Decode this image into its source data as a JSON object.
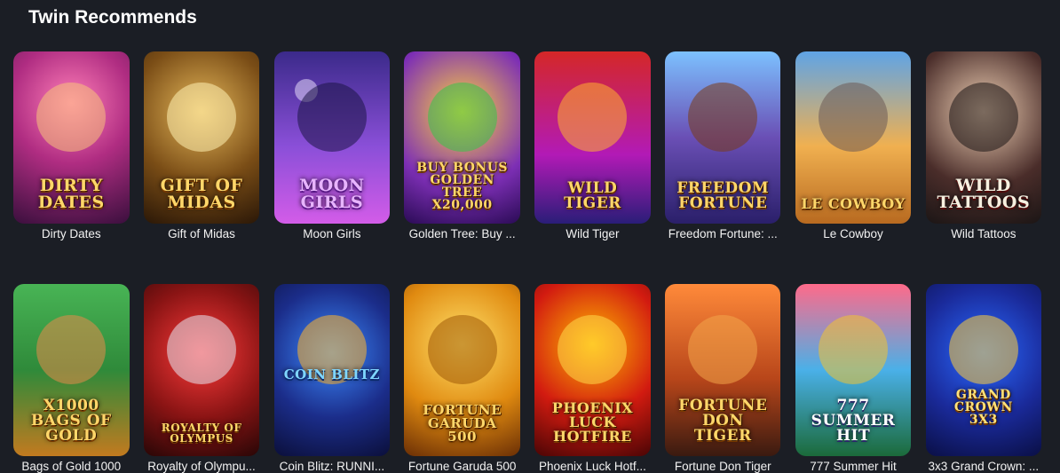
{
  "section": {
    "title": "Twin Recommends"
  },
  "rows": [
    [
      {
        "label": "Dirty Dates",
        "art": "DIRTY\nDATES"
      },
      {
        "label": "Gift of Midas",
        "art": "GIFT OF\nMIDAS"
      },
      {
        "label": "Moon Girls",
        "art": "MOON\nGIRLS"
      },
      {
        "label": "Golden Tree: Buy ...",
        "art": "BUY BONUS\nGOLDEN TREE\nx20,000"
      },
      {
        "label": "Wild Tiger",
        "art": "WILD TIGER"
      },
      {
        "label": "Freedom Fortune: ...",
        "art": "FREEDOM\nFORTUNE"
      },
      {
        "label": "Le Cowboy",
        "art": "LE COWBOY"
      },
      {
        "label": "Wild Tattoos",
        "art": "WILD\nTATTOOS"
      }
    ],
    [
      {
        "label": "Bags of Gold 1000",
        "art": "x1000\nBAGS OF\nGOLD"
      },
      {
        "label": "Royalty of Olympu...",
        "art": "ROYALTY OF OLYMPUS"
      },
      {
        "label": "Coin Blitz: RUNNI...",
        "art": "COIN BLITZ"
      },
      {
        "label": "Fortune Garuda 500",
        "art": "FORTUNE GARUDA\n500"
      },
      {
        "label": "Phoenix Luck Hotf...",
        "art": "PHOENIX\nLUCK\nHOTFIRE"
      },
      {
        "label": "Fortune Don Tiger",
        "art": "FORTUNE\nDON\nTIGER"
      },
      {
        "label": "777 Summer Hit",
        "art": "777\nSUMMER\nHIT"
      },
      {
        "label": "3x3 Grand Crown: ...",
        "art": "GRAND CROWN\n3x3"
      }
    ]
  ]
}
